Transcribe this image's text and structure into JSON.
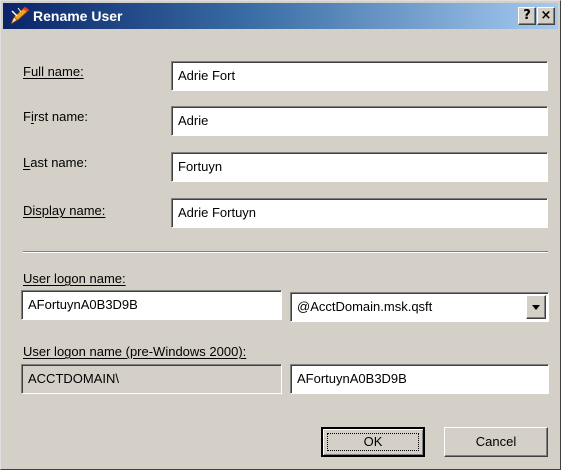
{
  "window": {
    "title": "Rename User",
    "help_glyph": "?",
    "close_glyph": "×"
  },
  "fields": {
    "full_name": {
      "label_mn": "F",
      "label_rest": "ull name:",
      "value": "Adrie Fort"
    },
    "first_name": {
      "label_pre": "F",
      "label_mn": "i",
      "label_rest": "rst name:",
      "value": "Adrie"
    },
    "last_name": {
      "label_mn": "L",
      "label_rest": "ast name:",
      "value": "Fortuyn"
    },
    "display_name": {
      "label": "Display name:",
      "value": "Adrie Fortuyn"
    }
  },
  "logon": {
    "label": "User logon name:",
    "value": "AFortuynA0B3D9B",
    "domain_value": "@AcctDomain.msk.qsft",
    "pre2000_label": "User logon name (pre-Windows 2000):",
    "pre2000_domain": "ACCTDOMAIN\\",
    "pre2000_value": "AFortuynA0B3D9B"
  },
  "buttons": {
    "ok": "OK",
    "cancel": "Cancel"
  },
  "icons": {
    "title": "rename-pencil-icon",
    "combo": "chevron-down-icon"
  },
  "colors": {
    "titlebar_start": "#0a246a",
    "titlebar_end": "#a6caf0",
    "dialog_bg": "#d4d0c8"
  }
}
